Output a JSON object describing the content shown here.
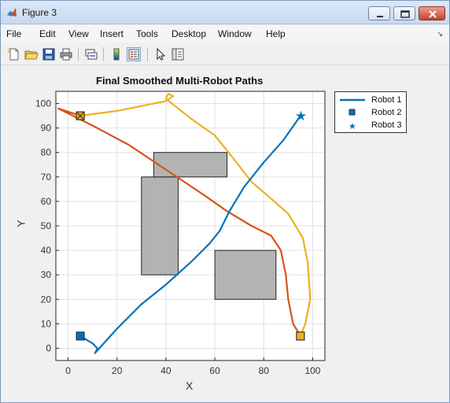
{
  "window": {
    "title": "Figure 3",
    "minimize_icon": "minimize-icon",
    "maximize_icon": "maximize-icon",
    "close_icon": "close-icon",
    "app_icon": "matlab-icon"
  },
  "menu": {
    "items": [
      "File",
      "Edit",
      "View",
      "Insert",
      "Tools",
      "Desktop",
      "Window",
      "Help"
    ],
    "overflow_icon": "menu-overflow-icon"
  },
  "toolbar": {
    "buttons": [
      {
        "icon": "new-figure-icon"
      },
      {
        "icon": "open-file-icon"
      },
      {
        "icon": "save-icon"
      },
      {
        "icon": "print-icon"
      },
      {
        "icon": "link-plot-icon"
      },
      {
        "icon": "insert-colorbar-icon"
      },
      {
        "icon": "insert-legend-icon",
        "active": true
      },
      {
        "icon": "edit-plot-pointer-icon"
      },
      {
        "icon": "property-inspector-icon"
      }
    ]
  },
  "colors": {
    "robot1": "#0072bd",
    "robot2": "#d95319",
    "robot3": "#edb120",
    "obstacle_fill": "#b3b3b3",
    "axes_bg": "#ffffff",
    "grid": "#e2e2e2"
  },
  "chart_data": {
    "type": "line",
    "title": "Final Smoothed Multi-Robot Paths",
    "xlabel": "X",
    "ylabel": "Y",
    "xlim": [
      -5,
      105
    ],
    "ylim": [
      -5,
      105
    ],
    "xticks": [
      0,
      20,
      40,
      60,
      80,
      100
    ],
    "yticks": [
      0,
      10,
      20,
      30,
      40,
      50,
      60,
      70,
      80,
      90,
      100
    ],
    "grid": true,
    "legend_position": "outside-top-right",
    "legend": [
      "Robot 1",
      "Robot 2",
      "Robot 3"
    ],
    "obstacles": [
      {
        "x": [
          30,
          45
        ],
        "y": [
          30,
          70
        ]
      },
      {
        "x": [
          35,
          65
        ],
        "y": [
          70,
          80
        ]
      },
      {
        "x": [
          60,
          85
        ],
        "y": [
          20,
          40
        ]
      }
    ],
    "series": [
      {
        "name": "Robot 1",
        "color": "#0072bd",
        "points": [
          [
            5,
            5
          ],
          [
            10,
            2
          ],
          [
            12,
            0
          ],
          [
            11,
            -2
          ],
          [
            20,
            8
          ],
          [
            30,
            18
          ],
          [
            40,
            26
          ],
          [
            50,
            35
          ],
          [
            58,
            43
          ],
          [
            62,
            48
          ],
          [
            66,
            56
          ],
          [
            72,
            66
          ],
          [
            80,
            76
          ],
          [
            88,
            85
          ],
          [
            95,
            95
          ]
        ],
        "start": [
          5,
          5
        ],
        "goal": [
          95,
          95
        ]
      },
      {
        "name": "Robot 2",
        "color": "#d95319",
        "points": [
          [
            5,
            95
          ],
          [
            -4,
            98
          ],
          [
            10,
            91
          ],
          [
            25,
            83
          ],
          [
            40,
            73
          ],
          [
            55,
            63
          ],
          [
            65,
            56
          ],
          [
            75,
            50
          ],
          [
            83,
            46
          ],
          [
            87,
            40
          ],
          [
            89,
            30
          ],
          [
            90,
            20
          ],
          [
            92,
            10
          ],
          [
            95,
            5
          ]
        ],
        "start": [
          5,
          95
        ],
        "goal": [
          95,
          5
        ]
      },
      {
        "name": "Robot 3",
        "color": "#edb120",
        "points": [
          [
            5,
            95
          ],
          [
            20,
            97
          ],
          [
            40,
            101
          ],
          [
            43,
            103
          ],
          [
            41,
            104
          ],
          [
            40,
            102
          ],
          [
            50,
            94
          ],
          [
            60,
            87
          ],
          [
            68,
            77
          ],
          [
            75,
            68
          ],
          [
            82,
            62
          ],
          [
            90,
            55
          ],
          [
            96,
            45
          ],
          [
            98,
            35
          ],
          [
            99,
            20
          ],
          [
            97,
            10
          ],
          [
            95,
            5
          ]
        ],
        "start": [
          5,
          95
        ],
        "goal": [
          95,
          5
        ]
      }
    ]
  }
}
